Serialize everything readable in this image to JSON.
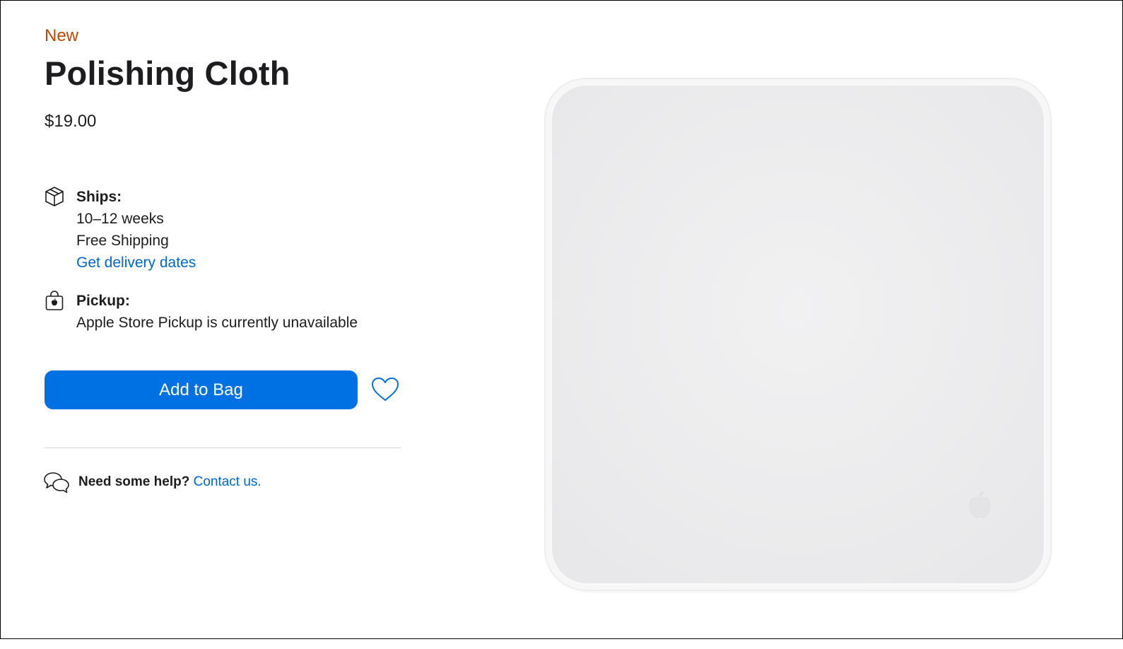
{
  "product": {
    "badge": "New",
    "name": "Polishing Cloth",
    "price": "$19.00"
  },
  "shipping": {
    "heading": "Ships:",
    "lead_time": "10–12 weeks",
    "shipping_cost": "Free Shipping",
    "delivery_link": "Get delivery dates",
    "icon": "box-icon"
  },
  "pickup": {
    "heading": "Pickup:",
    "status": "Apple Store Pickup is currently unavailable",
    "icon": "shopping-bag-icon"
  },
  "actions": {
    "add_to_bag": "Add to Bag",
    "favorite_icon": "heart-icon"
  },
  "help": {
    "question": "Need some help?",
    "contact_link": "Contact us.",
    "icon": "chat-bubbles-icon"
  },
  "colors": {
    "badge": "#bf4800",
    "accent": "#0071e3",
    "link": "#0066cc",
    "text": "#1d1d1f"
  }
}
